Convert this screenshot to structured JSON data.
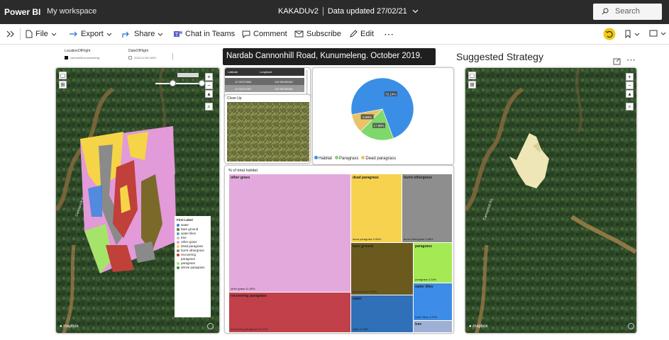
{
  "topbar": {
    "brand": "Power BI",
    "workspace": "My workspace",
    "report_name": "KAKADUv2",
    "data_updated": "Data updated 27/02/21",
    "search_placeholder": "Search"
  },
  "toolbar": {
    "file": "File",
    "export": "Export",
    "share": "Share",
    "chat": "Chat in Teams",
    "comment": "Comment",
    "subscribe": "Subscribe",
    "edit": "Edit"
  },
  "slicers": {
    "location_label": "LocationOfFlight",
    "location_value": "cannonhill-kunumeleng",
    "date_label": "DateOfFlight",
    "date_value": "2018-12-05-1600"
  },
  "report_title": "Nardab Cannonhill Road, Kunumeleng.  October 2019.",
  "suggested_title": "Suggested Strategy",
  "map": {
    "attribution": "mapbox",
    "legend_title": "First Label",
    "legend": [
      {
        "label": "water",
        "color": "#2e86de"
      },
      {
        "label": "bare ground",
        "color": "#7a6a2a"
      },
      {
        "label": "water lilies",
        "color": "#4aa3df"
      },
      {
        "label": "tree",
        "color": "#cfc3a0"
      },
      {
        "label": "other grass",
        "color": "#e29ad8"
      },
      {
        "label": "dead paragrass",
        "color": "#f5d547"
      },
      {
        "label": "burnt othergrass",
        "color": "#8a8a8a"
      },
      {
        "label": "recovering paragrass",
        "color": "#c0403a"
      },
      {
        "label": "paragrass",
        "color": "#a6e36b"
      },
      {
        "label": "dense paragrass",
        "color": "#3d8f3d"
      }
    ]
  },
  "coords_table": {
    "headers": [
      "Latitude",
      "Longitude"
    ],
    "rows": [
      [
        "12.33707854",
        "132.59189183"
      ],
      [
        "12.33707287",
        "132.59189185"
      ]
    ]
  },
  "closeup_label": "Close Up",
  "colors": {
    "habitat": "#3a8ee6",
    "paragrass": "#7fd86b",
    "dead_paragrass": "#e8c36a"
  },
  "chart_data": [
    {
      "type": "pie",
      "labels": [
        "Habitat",
        "Paragrass",
        "Dead paragrass"
      ],
      "values": [
        72.14,
        17.98,
        9.88
      ],
      "data_labels": [
        "72.14%",
        "17.98%",
        "9.88%"
      ]
    },
    {
      "type": "treemap",
      "title": "% of total habitat",
      "items": [
        {
          "name": "other grass",
          "value": 41.85,
          "label": "other grass 41.85%",
          "color": "#e4a9dc"
        },
        {
          "name": "recovering paragrass",
          "value": 10.01,
          "label": "recovering paragrass 10.01%",
          "color": "#c1404a"
        },
        {
          "name": "dead paragrass",
          "value": 9.88,
          "label": "dead paragrass 9.88%",
          "color": "#f7d24f"
        },
        {
          "name": "burnt othergrass",
          "value": 9.88,
          "label": "burnt othergrass 9.88%",
          "color": "#8e8e8e"
        },
        {
          "name": "bare ground",
          "value": 9.56,
          "label": "bare ground 9.56%",
          "color": "#6b5a1e"
        },
        {
          "name": "water",
          "value": 6.36,
          "label": "water 6.36%",
          "color": "#2f70b8"
        },
        {
          "name": "paragrass",
          "value": 4.34,
          "label": "paragrass 4.34%",
          "color": "#a3ea55"
        },
        {
          "name": "water lilies",
          "value": 4.29,
          "label": "water lilies 4.29%",
          "color": "#3d8ce8"
        },
        {
          "name": "tree",
          "value": null,
          "label": "",
          "color": "#9fb0d6"
        }
      ]
    }
  ]
}
